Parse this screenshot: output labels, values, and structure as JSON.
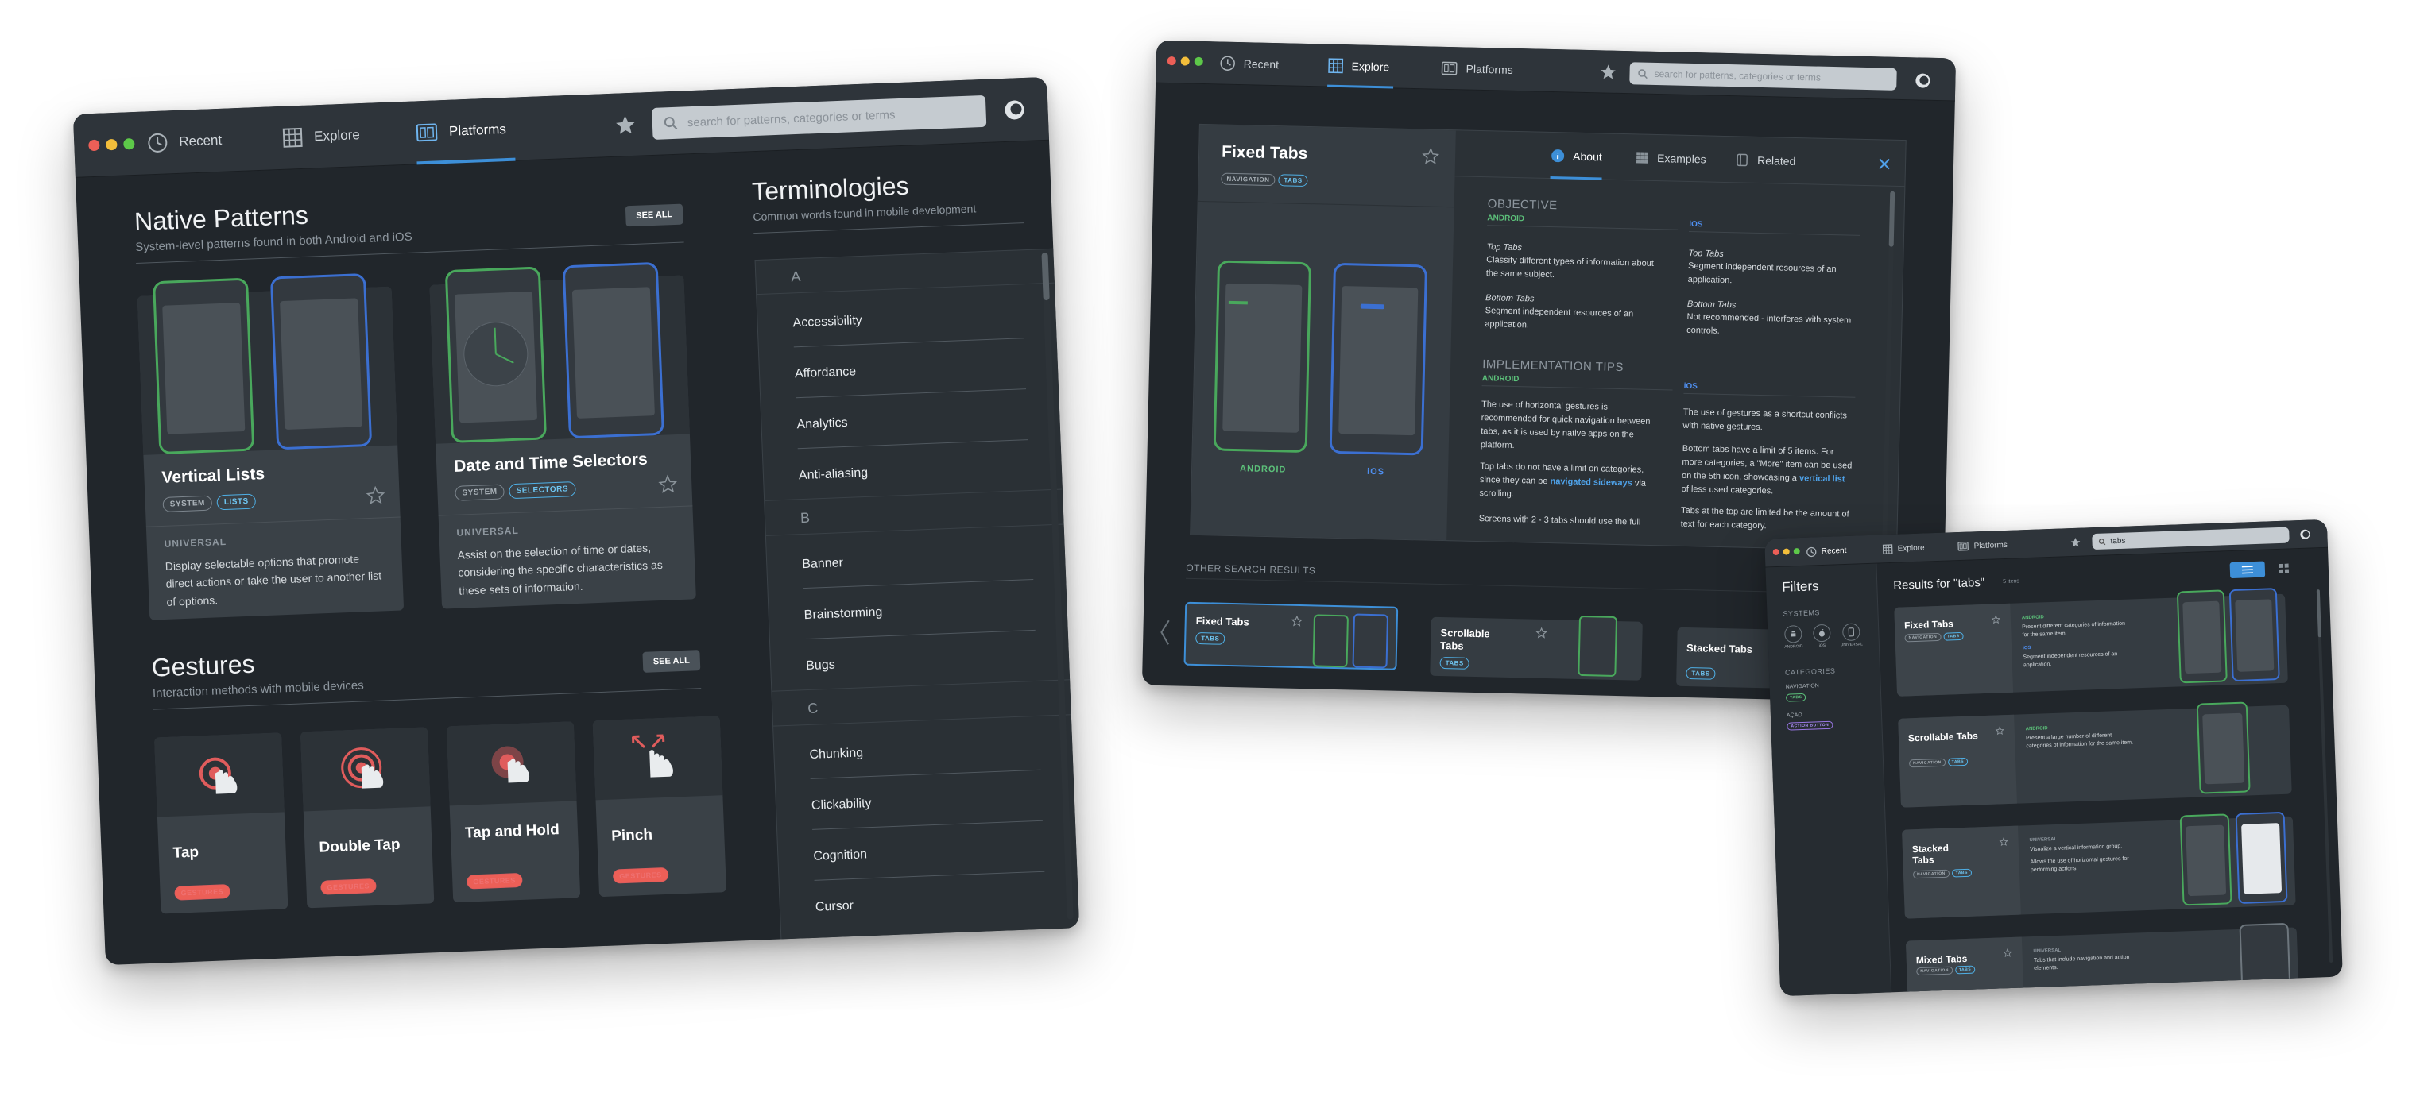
{
  "main_window": {
    "tabs": [
      {
        "label": "Recent",
        "icon": "clock-icon"
      },
      {
        "label": "Explore",
        "icon": "grid-icon"
      },
      {
        "label": "Platforms",
        "icon": "platforms-icon"
      }
    ],
    "active_tab": "Platforms",
    "search_placeholder": "search for patterns, categories or terms",
    "native": {
      "title": "Native Patterns",
      "subtitle": "System-level patterns found in both Android and iOS",
      "see_all": "SEE ALL",
      "cards": [
        {
          "title": "Vertical Lists",
          "tags": [
            "SYSTEM",
            "LISTS"
          ],
          "label": "UNIVERSAL",
          "desc": "Display selectable options that promote direct actions or take the user to another list of options."
        },
        {
          "title": "Date and Time Selectors",
          "tags": [
            "SYSTEM",
            "SELECTORS"
          ],
          "label": "UNIVERSAL",
          "desc": "Assist on the selection of time or dates, considering the specific characteristics as these sets of information."
        }
      ]
    },
    "gestures": {
      "title": "Gestures",
      "subtitle": "Interaction methods with mobile devices",
      "see_all": "SEE ALL",
      "items": [
        {
          "title": "Tap",
          "tag": "GESTURES",
          "icon": "tap-gesture-icon"
        },
        {
          "title": "Double Tap",
          "tag": "GESTURES",
          "icon": "double-tap-gesture-icon"
        },
        {
          "title": "Tap and Hold",
          "tag": "GESTURES",
          "icon": "tap-hold-gesture-icon"
        },
        {
          "title": "Pinch",
          "tag": "GESTURES",
          "icon": "pinch-gesture-icon"
        }
      ]
    },
    "terminologies": {
      "title": "Terminologies",
      "subtitle": "Common words found in mobile development",
      "letters": [
        "A",
        "B",
        "C"
      ],
      "a_terms": [
        "Accessibility",
        "Affordance",
        "Analytics",
        "Anti-aliasing"
      ],
      "b_terms": [
        "Banner",
        "Brainstorming",
        "Bugs"
      ],
      "c_terms": [
        "Chunking",
        "Clickability",
        "Cognition",
        "Cursor"
      ]
    }
  },
  "detail_window": {
    "tabs": [
      {
        "label": "Recent",
        "icon": "clock-icon"
      },
      {
        "label": "Explore",
        "icon": "grid-icon"
      },
      {
        "label": "Platforms",
        "icon": "platforms-icon"
      }
    ],
    "search_placeholder": "search for patterns, categories or terms",
    "pattern_title": "Fixed Tabs",
    "pattern_tags": [
      "NAVIGATION",
      "TABS"
    ],
    "android_label": "ANDROID",
    "ios_label": "iOS",
    "panel_tabs": [
      {
        "label": "About",
        "icon": "info-icon"
      },
      {
        "label": "Examples",
        "icon": "grid-icon"
      },
      {
        "label": "Related",
        "icon": "related-icon"
      }
    ],
    "objective_heading": "OBJECTIVE",
    "android_col": {
      "heading": "ANDROID",
      "h1": "Top Tabs",
      "t1": "Classify different types of information about the same subject.",
      "h2": "Bottom Tabs",
      "t2": "Segment independent resources of an application."
    },
    "ios_col": {
      "heading": "iOS",
      "h1": "Top Tabs",
      "t1": "Segment independent resources of an application.",
      "h2": "Bottom Tabs",
      "t2": "Not recommended - interferes with system controls."
    },
    "impl_heading": "IMPLEMENTATION TIPS",
    "impl_android": {
      "heading": "ANDROID",
      "p1": "The use of horizontal gestures is recommended for quick navigation between tabs, as it is used by native apps on the platform.",
      "p2a": "Top tabs do not have a limit on categories, since they can be",
      "p2link": "navigated sideways",
      "p2b": "via scrolling.",
      "p3": "Screens with 2 - 3 tabs should use the full"
    },
    "impl_ios": {
      "heading": "iOS",
      "p1": "The use of gestures as a shortcut conflicts with native gestures.",
      "p2a": "Bottom tabs have a limit of 5 items. For more categories, a \"More\" item can be used on the 5th icon, showcasing a",
      "p2link": "vertical list",
      "p2b": "of less used categories.",
      "p3": "Tabs at the top are limited be the amount of text for each category."
    },
    "other_results_label": "OTHER SEARCH RESULTS",
    "other_results": [
      {
        "title": "Fixed Tabs",
        "tag": "TABS"
      },
      {
        "title": "Scrollable Tabs",
        "tag": "TABS"
      },
      {
        "title": "Stacked Tabs",
        "tag": "TABS"
      }
    ]
  },
  "results_window": {
    "tabs": [
      {
        "label": "Recent",
        "icon": "clock-icon"
      },
      {
        "label": "Explore",
        "icon": "grid-icon"
      },
      {
        "label": "Platforms",
        "icon": "platforms-icon"
      }
    ],
    "search_value": "tabs",
    "filters_title": "Filters",
    "systems_label": "SYSTEMS",
    "systems": [
      "ANDROID",
      "iOS",
      "UNIVERSAL"
    ],
    "categories_label": "CATEGORIES",
    "navigation_label": "NAVIGATION",
    "navigation_tag": "TABS",
    "acao_label": "AÇÃO",
    "acao_tag": "ACTION BUTTON",
    "results_title": "Results for \"tabs\"",
    "results_count": "5 itens",
    "results": [
      {
        "title": "Fixed Tabs",
        "tags": [
          "NAVIGATION",
          "TABS"
        ],
        "l1": "ANDROID",
        "d1": "Present different categories of information for the same item.",
        "l2": "iOS",
        "d2": "Segment independent resources of an application."
      },
      {
        "title": "Scrollable Tabs",
        "tags": [
          "NAVIGATION",
          "TABS"
        ],
        "l1": "ANDROID",
        "d1": "Present a large number of different categories of information for the same item.",
        "l2": "",
        "d2": ""
      },
      {
        "title": "Stacked Tabs",
        "tags": [
          "NAVIGATION",
          "TABS"
        ],
        "l1": "UNIVERSAL",
        "d1": "Visualize a vertical information group.",
        "l2": "",
        "d2": "Allows the use of horizontal gestures for performing actions."
      },
      {
        "title": "Mixed Tabs",
        "tags": [
          "NAVIGATION",
          "TABS"
        ],
        "l1": "UNIVERSAL",
        "d1": "Tabs that include navigation and action elements.",
        "l2": "",
        "d2": ""
      }
    ]
  },
  "colors": {
    "background": "#21262b",
    "titlebar": "#2e343a",
    "accent": "#3d8fd8",
    "android": "#49a85c",
    "ios": "#3b6fd1",
    "gesture": "#e05c5c"
  }
}
